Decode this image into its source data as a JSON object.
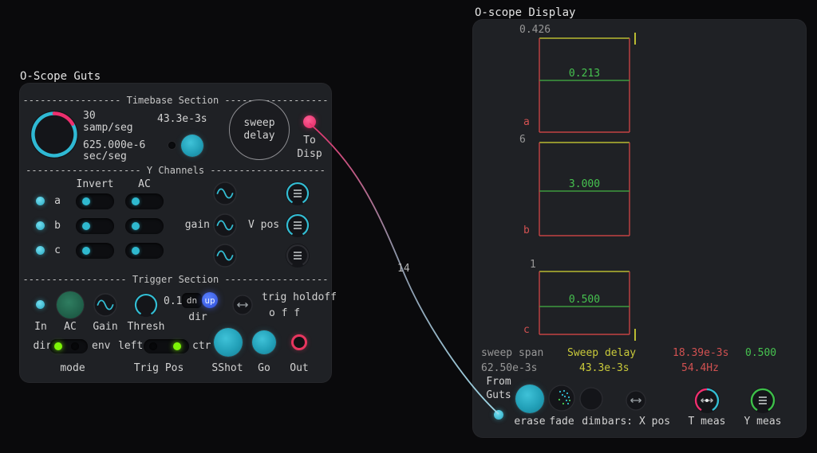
{
  "colors": {
    "teal": "#2fb9d4",
    "pink": "#ee2f6e",
    "green": "#46c24f",
    "yellow": "#c9c93a",
    "red": "#d15151",
    "blue": "#3f63e8",
    "led_green": "#7df407"
  },
  "guts": {
    "title": "O-Scope Guts",
    "timebase": {
      "header": "----------------- Timebase Section ------------------",
      "samp_value": "30",
      "samp_unit": "samp/seg",
      "sec_value": "625.000e-6",
      "sec_unit": "sec/seg",
      "delay_value": "43.3e-3s",
      "knob_label": "sweep delay",
      "to_disp": "To Disp"
    },
    "channels": {
      "header": "-------------------- Y  Channels --------------------",
      "invert": "Invert",
      "ac": "AC",
      "rows": [
        {
          "label": "a"
        },
        {
          "label": "b"
        },
        {
          "label": "c"
        }
      ],
      "gain": "gain",
      "vpos": "V pos"
    },
    "trigger": {
      "header": "------------------ Trigger Section ------------------",
      "in": "In",
      "ac": "AC",
      "gain": "Gain",
      "thresh": "Thresh",
      "thresh_value": "0.1",
      "dn": "dn",
      "up": "up",
      "dir": "dir",
      "holdoff": "trig holdoff",
      "holdoff_value": "o f f",
      "mode_dir": "dir",
      "mode_env": "env",
      "mode": "mode",
      "pos_left": "left",
      "pos_ctr": "ctr",
      "pos_label": "Trig Pos",
      "sshot": "SShot",
      "go": "Go",
      "out": "Out"
    }
  },
  "cable": {
    "label": "14"
  },
  "display": {
    "title": "O-scope Display",
    "traces": [
      {
        "name": "a",
        "scale": "0.426",
        "measure": "0.213"
      },
      {
        "name": "b",
        "scale": "6",
        "measure": "3.000"
      },
      {
        "name": "c",
        "scale": "1",
        "measure": "0.500"
      }
    ],
    "readouts": {
      "span_label": "sweep span",
      "span_value": "62.50e-3s",
      "delay_label": "Sweep delay",
      "delay_value": "43.3e-3s",
      "tmeas_value": "18.39e-3s",
      "freq_value": "54.4Hz",
      "ymeas_value": "0.500"
    },
    "from_guts": "From Guts",
    "controls": {
      "erase": "erase",
      "fade": "fade",
      "dim": "dim",
      "bars": "bars: X pos",
      "tmeas": "T meas",
      "ymeas": "Y meas"
    }
  }
}
